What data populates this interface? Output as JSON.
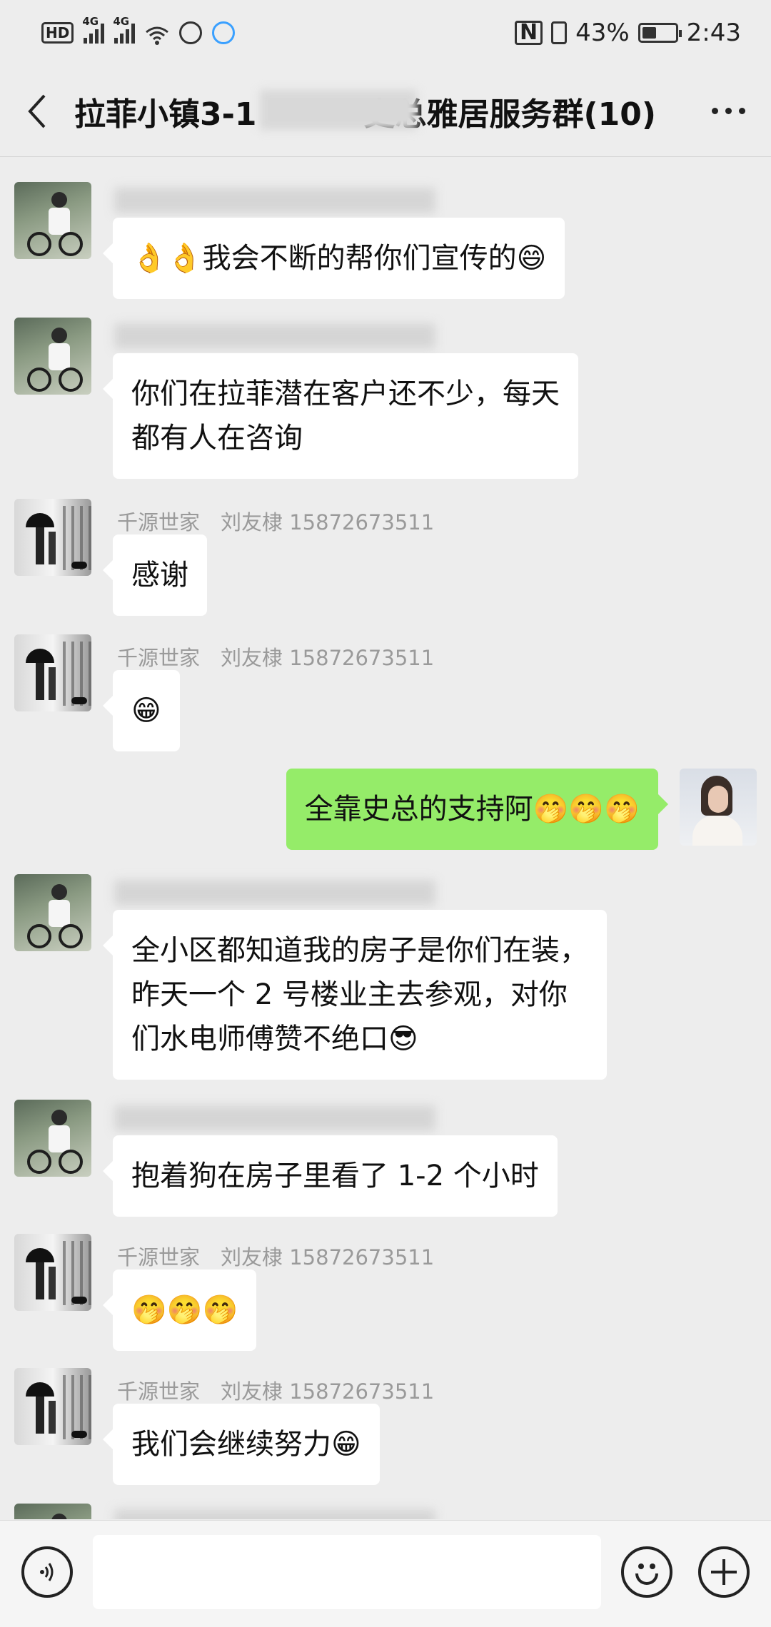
{
  "status_bar": {
    "hd": "HD",
    "net1": "4G",
    "net2": "4G",
    "battery_text": "43%",
    "battery_level": 0.43,
    "time": "2:43"
  },
  "nav": {
    "title_part1": "拉菲小镇3-1",
    "title_part2": "史总雅居服务群(10)"
  },
  "messages": [
    {
      "sender": "",
      "text": "👌👌我会不断的帮你们宣传的😄",
      "avatar": "man"
    },
    {
      "sender": "",
      "text_lines": [
        "你们在拉菲潜在客户还不少，每天",
        "都有人在咨询"
      ],
      "avatar": "man"
    },
    {
      "sender": "千源世家　刘友棣 15872673511",
      "text": "感谢",
      "avatar": "bw"
    },
    {
      "sender": "千源世家　刘友棣 15872673511",
      "text": "😁",
      "avatar": "bw"
    },
    {
      "sender": "",
      "text": "全靠史总的支持阿🤭🤭🤭",
      "avatar": "me",
      "mine": true
    },
    {
      "sender": "",
      "text_lines": [
        "全小区都知道我的房子是你们在装，",
        "昨天一个 2 号楼业主去参观，对你",
        "们水电师傅赞不绝口😎"
      ],
      "avatar": "man"
    },
    {
      "sender": "",
      "text": "抱着狗在房子里看了 1-2 个小时",
      "avatar": "man"
    },
    {
      "sender": "千源世家　刘友棣 15872673511",
      "text": "🤭🤭🤭",
      "avatar": "bw"
    },
    {
      "sender": "千源世家　刘友棣 15872673511",
      "text": "我们会继续努力😁",
      "avatar": "bw"
    }
  ],
  "icons": {
    "back": "chevron-left-icon",
    "more": "more-dots-icon",
    "voice": "voice-icon",
    "emoji": "emoji-icon",
    "plus": "plus-icon"
  },
  "colors": {
    "background": "#ededed",
    "my_bubble": "#95ec69",
    "other_bubble": "#ffffff"
  }
}
